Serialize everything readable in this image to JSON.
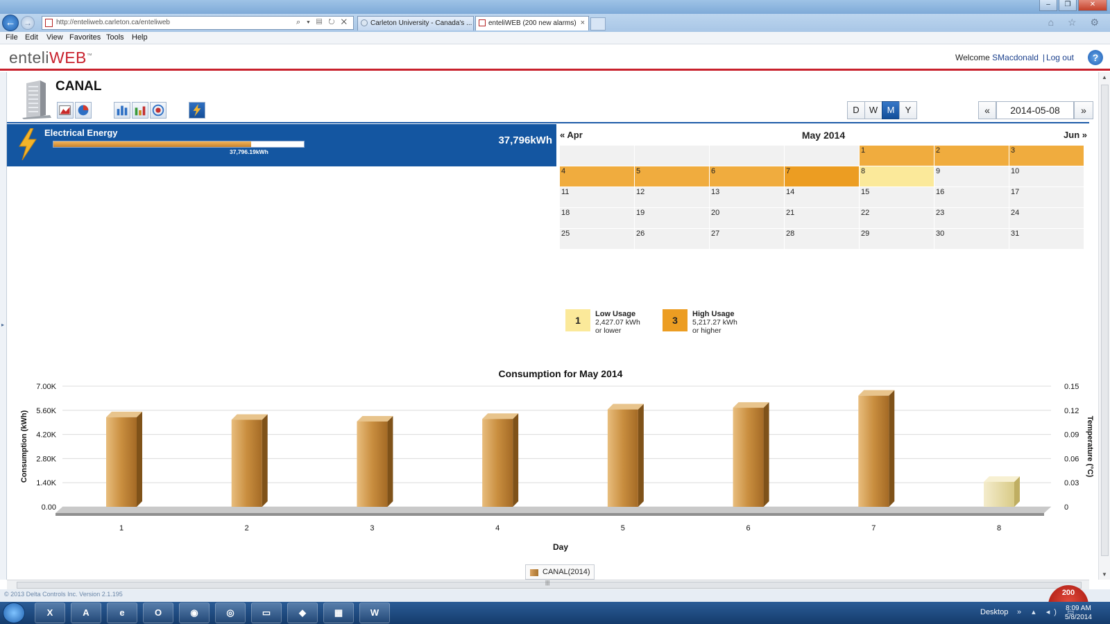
{
  "browser": {
    "title": "",
    "url": "http://enteliweb.carleton.ca/enteliweb",
    "address_tools": "⌕ ▾ ▤ ↻ ✕",
    "tabs": [
      {
        "label": "Carleton University - Canada's ..."
      },
      {
        "label": "enteliWEB (200 new alarms)"
      }
    ],
    "tab_close": "×",
    "right_icons": "⌂ ☆ ⚙",
    "window_controls": [
      "–",
      "❐",
      "✕"
    ]
  },
  "menu": [
    "File",
    "Edit",
    "View",
    "Favorites",
    "Tools",
    "Help"
  ],
  "app": {
    "logo_left": "enteli",
    "logo_right": "WEB",
    "logo_tm": "™",
    "welcome_prefix": "Welcome",
    "user": "SMacdonald",
    "separator": "|",
    "logout": "Log out",
    "help": "?"
  },
  "page": {
    "title": "CANAL",
    "view_modes": [
      "D",
      "W",
      "M",
      "Y"
    ],
    "active_view": "M",
    "prev": "«",
    "date": "2014-05-08",
    "next": "»"
  },
  "energy": {
    "title": "Electrical Energy",
    "bar_label": "37,796.19kWh",
    "bar_fraction": 0.79,
    "total": "37,796kWh"
  },
  "calendar": {
    "prev": "« Apr",
    "title": "May 2014",
    "next": "Jun »",
    "leading_blanks": 4,
    "days": [
      {
        "d": "1",
        "level": "high"
      },
      {
        "d": "2",
        "level": "high"
      },
      {
        "d": "3",
        "level": "high"
      },
      {
        "d": "4",
        "level": "high"
      },
      {
        "d": "5",
        "level": "high"
      },
      {
        "d": "6",
        "level": "high"
      },
      {
        "d": "7",
        "level": "top"
      },
      {
        "d": "8",
        "level": "low"
      },
      {
        "d": "9",
        "level": "none"
      },
      {
        "d": "10",
        "level": "none"
      },
      {
        "d": "11",
        "level": "none"
      },
      {
        "d": "12",
        "level": "none"
      },
      {
        "d": "13",
        "level": "none"
      },
      {
        "d": "14",
        "level": "none"
      },
      {
        "d": "15",
        "level": "none"
      },
      {
        "d": "16",
        "level": "none"
      },
      {
        "d": "17",
        "level": "none"
      },
      {
        "d": "18",
        "level": "none"
      },
      {
        "d": "19",
        "level": "none"
      },
      {
        "d": "20",
        "level": "none"
      },
      {
        "d": "21",
        "level": "none"
      },
      {
        "d": "22",
        "level": "none"
      },
      {
        "d": "23",
        "level": "none"
      },
      {
        "d": "24",
        "level": "none"
      },
      {
        "d": "25",
        "level": "none"
      },
      {
        "d": "26",
        "level": "none"
      },
      {
        "d": "27",
        "level": "none"
      },
      {
        "d": "28",
        "level": "none"
      },
      {
        "d": "29",
        "level": "none"
      },
      {
        "d": "30",
        "level": "none"
      },
      {
        "d": "31",
        "level": "none"
      }
    ]
  },
  "usage_legend": {
    "low": {
      "box": "1",
      "title": "Low Usage",
      "value": "2,427.07 kWh",
      "note": "or lower"
    },
    "high": {
      "box": "3",
      "title": "High Usage",
      "value": "5,217.27 kWh",
      "note": "or higher"
    }
  },
  "chart_data": {
    "type": "bar",
    "title": "Consumption for May 2014",
    "xlabel": "Day",
    "ylabel": "Consumption (kWh)",
    "y2label": "Temperature (°C)",
    "categories": [
      "1",
      "2",
      "3",
      "4",
      "5",
      "6",
      "7",
      "8"
    ],
    "series": [
      {
        "name": "CANAL(2014)",
        "values": [
          5200,
          5050,
          4950,
          5100,
          5650,
          5750,
          6450,
          1450
        ]
      }
    ],
    "ylim": [
      0,
      7000
    ],
    "yticks": [
      "0.00",
      "1.40K",
      "2.80K",
      "4.20K",
      "5.60K",
      "7.00K"
    ],
    "y2lim": [
      0,
      0.15
    ],
    "y2ticks": [
      "0",
      "0.03",
      "0.06",
      "0.09",
      "0.12",
      "0.15"
    ],
    "partial_day": "8",
    "grid": true,
    "legend_position": "bottom-center",
    "colors": {
      "bar": "#c98e3f",
      "partial": "#e8dca0"
    }
  },
  "footer": {
    "copyright": "© 2013 Delta Controls Inc. Version 2.1.195",
    "alarm_count": "200",
    "scroll_grip": "|||"
  },
  "taskbar": {
    "apps": [
      "excel-icon",
      "acrobat-icon",
      "internet-explorer-icon",
      "outlook-icon",
      "firefox-icon",
      "chrome-icon",
      "explorer-folder-icon",
      "network-icon",
      "calculator-icon",
      "word-icon"
    ],
    "app_glyphs": [
      "X",
      "A",
      "e",
      "O",
      "◉",
      "◎",
      "▭",
      "◆",
      "▦",
      "W"
    ],
    "desktop_label": "Desktop",
    "tray": "» ▴ ◂) ▭",
    "time": "8:09 AM",
    "date": "5/8/2014"
  }
}
